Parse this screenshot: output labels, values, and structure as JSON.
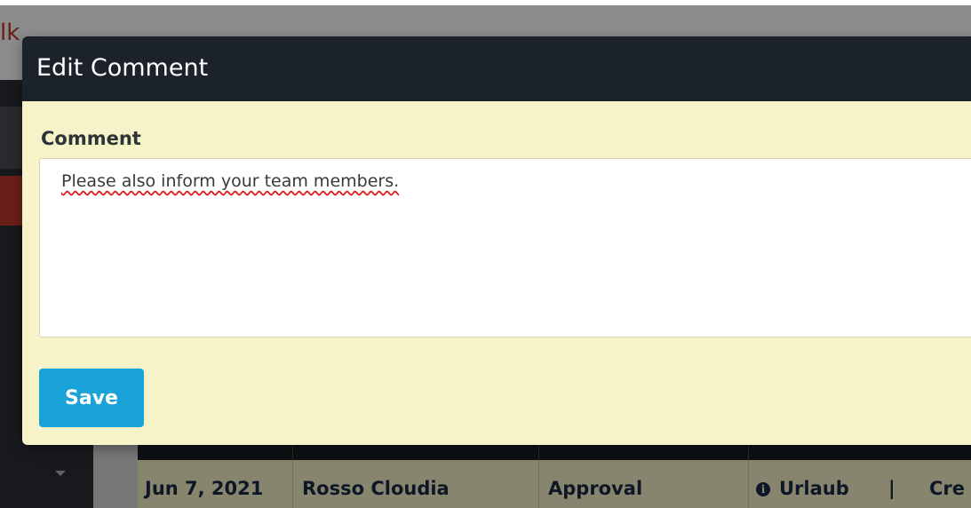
{
  "background": {
    "brand_text": "lk",
    "table_row": {
      "date": "Jun 7, 2021",
      "name": "Rosso Cloudia",
      "type": "Approval",
      "category": "Urlaub",
      "separator": "|",
      "extra": "Cre"
    }
  },
  "modal": {
    "title": "Edit Comment",
    "comment": {
      "label": "Comment",
      "value": "Please also inform your team members."
    },
    "save_label": "Save"
  },
  "colors": {
    "modal_header": "#1c2229",
    "modal_body": "#f7f3c8",
    "save_button": "#1aa3d9",
    "brand_accent": "#c0392b"
  },
  "icons": {
    "info": "info-circle-icon",
    "dropdown": "caret-down-icon"
  }
}
